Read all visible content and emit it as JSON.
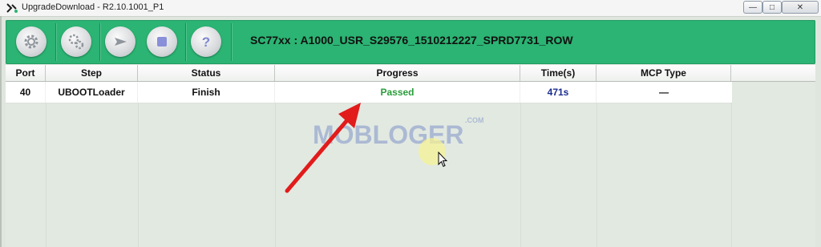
{
  "window": {
    "title": "UpgradeDownload - R2.10.1001_P1",
    "controls": {
      "minimize": "—",
      "maximize": "□",
      "close": "✕"
    }
  },
  "toolbar": {
    "buttons": [
      {
        "name": "load-packet",
        "icon": "gear-icon"
      },
      {
        "name": "settings",
        "icon": "gears-icon"
      },
      {
        "name": "start-download",
        "icon": "play-icon"
      },
      {
        "name": "stop-download",
        "icon": "stop-icon"
      },
      {
        "name": "help",
        "icon": "help-icon"
      }
    ],
    "firmware_label": "SC77xx : A1000_USR_S29576_1510212227_SPRD7731_ROW"
  },
  "table": {
    "columns": [
      "Port",
      "Step",
      "Status",
      "Progress",
      "Time(s)",
      "MCP Type"
    ],
    "rows": [
      {
        "port": "40",
        "step": "UBOOTLoader",
        "status": "Finish",
        "progress": "Passed",
        "time": "471s",
        "mcp_type": "—"
      }
    ]
  },
  "watermark": {
    "text": "MOBLOGER",
    "suffix": ".COM"
  },
  "colors": {
    "toolbar_green": "#2bb473",
    "passed_green": "#2a9d3a",
    "time_blue": "#1b2c8f",
    "arrow_red": "#e21b1b"
  }
}
